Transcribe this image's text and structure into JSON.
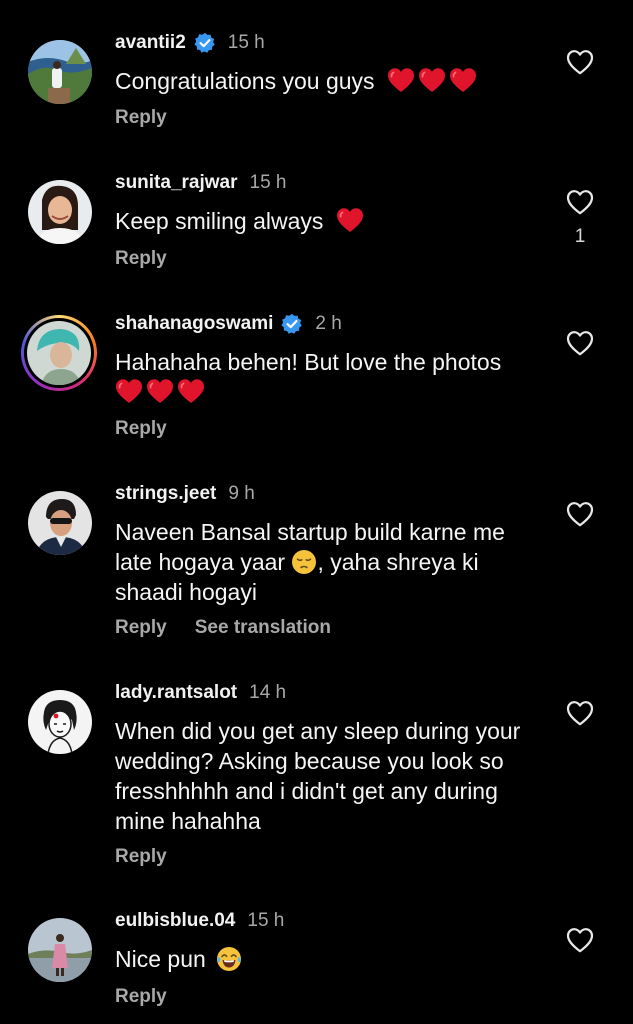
{
  "comments": [
    {
      "username": "avantii2",
      "verified": true,
      "time": "15 h",
      "lines": [
        "Congratulations you guys"
      ],
      "emoji": [
        "red-heart",
        "red-heart",
        "red-heart"
      ],
      "reply": "Reply",
      "likes": ""
    },
    {
      "username": "sunita_rajwar",
      "verified": false,
      "time": "15 h",
      "lines": [
        "Keep smiling always"
      ],
      "emoji": [
        "red-heart"
      ],
      "reply": "Reply",
      "likes": "1"
    },
    {
      "username": "shahanagoswami",
      "verified": true,
      "time": "2 h",
      "has_story": true,
      "lines": [
        "Hahahaha behen! But love the photos"
      ],
      "emoji": [
        "red-heart",
        "red-heart",
        "red-heart"
      ],
      "reply": "Reply",
      "likes": ""
    },
    {
      "username": "strings.jeet",
      "verified": false,
      "time": "9 h",
      "lines": [
        "Naveen Bansal startup build karne me",
        "late hogaya yaar",
        ", yaha shreya ki",
        "shaadi hogayi"
      ],
      "emoji": [
        "pensive-face"
      ],
      "reply": "Reply",
      "see_translation": "See translation",
      "likes": ""
    },
    {
      "username": "lady.rantsalot",
      "verified": false,
      "time": "14 h",
      "lines": [
        "When did you get any sleep during your",
        "wedding? Asking because you look so",
        "fresshhhhh and i didn't get any during",
        "mine hahahha"
      ],
      "reply": "Reply",
      "likes": ""
    },
    {
      "username": "eulbisblue.04",
      "verified": false,
      "time": "15 h",
      "lines": [
        "Nice pun"
      ],
      "emoji": [
        "face-with-tears-of-joy"
      ],
      "reply": "Reply",
      "likes": ""
    }
  ],
  "colors": {
    "background": "#000000",
    "verified_badge": "#3897f0",
    "heart_emoji": "#e0142b",
    "secondary_text": "#a8a8a8"
  },
  "icons": {
    "like": "heart-outline-icon",
    "verified": "verified-badge-icon"
  }
}
